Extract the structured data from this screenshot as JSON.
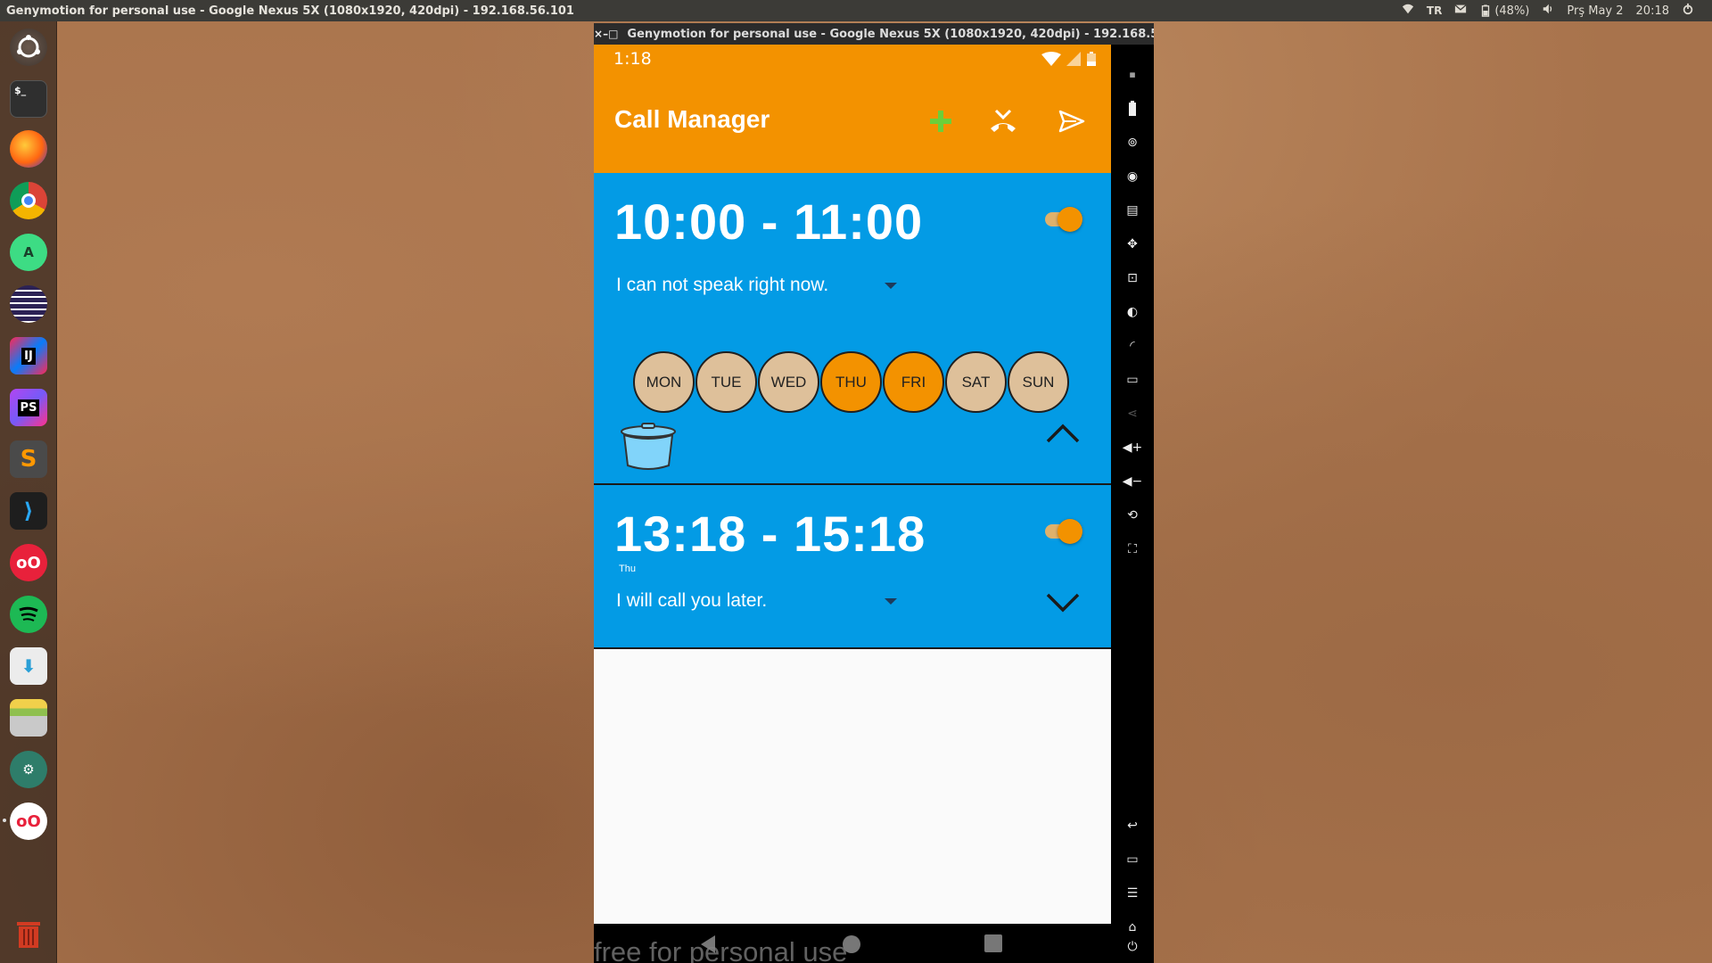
{
  "top_panel": {
    "window_title": "Genymotion for personal use - Google Nexus 5X (1080x1920, 420dpi) - 192.168.56.101",
    "keyboard_layout": "TR",
    "battery": "(48%)",
    "date": "Prş May 2",
    "time": "20:18"
  },
  "launcher": {
    "items": [
      "ubuntu-dash",
      "terminal",
      "firefox",
      "chrome",
      "android-studio",
      "eclipse",
      "intellij",
      "phpstorm",
      "sublime-text",
      "vscode",
      "flickr-like-app",
      "spotify",
      "software-updater",
      "file-archive",
      "settings-tool",
      "flickr-like-app-2",
      "trash"
    ]
  },
  "emulator": {
    "title": "Genymotion for personal use - Google Nexus 5X (1080x1920, 420dpi) - 192.168.56.101",
    "close_glyph": "×",
    "min_glyph": "–",
    "max_glyph": "□",
    "watermark": "free for personal use"
  },
  "phone": {
    "status_time": "1:18",
    "app_title": "Call Manager",
    "colors": {
      "primary": "#f39200",
      "card": "#039be5",
      "day_off": "#dec09a",
      "day_on": "#f39200",
      "add_green": "#6ccf3a"
    },
    "rules": [
      {
        "time_range": "10:00 - 11:00",
        "enabled": true,
        "message": "I can not speak right now.",
        "expanded": true,
        "days": [
          {
            "label": "MON",
            "active": false
          },
          {
            "label": "TUE",
            "active": false
          },
          {
            "label": "WED",
            "active": false
          },
          {
            "label": "THU",
            "active": true
          },
          {
            "label": "FRI",
            "active": true
          },
          {
            "label": "SAT",
            "active": false
          },
          {
            "label": "SUN",
            "active": false
          }
        ]
      },
      {
        "time_range": "13:18 - 15:18",
        "days_summary": "Thu",
        "enabled": true,
        "message": "I will call you later.",
        "expanded": false
      }
    ]
  }
}
